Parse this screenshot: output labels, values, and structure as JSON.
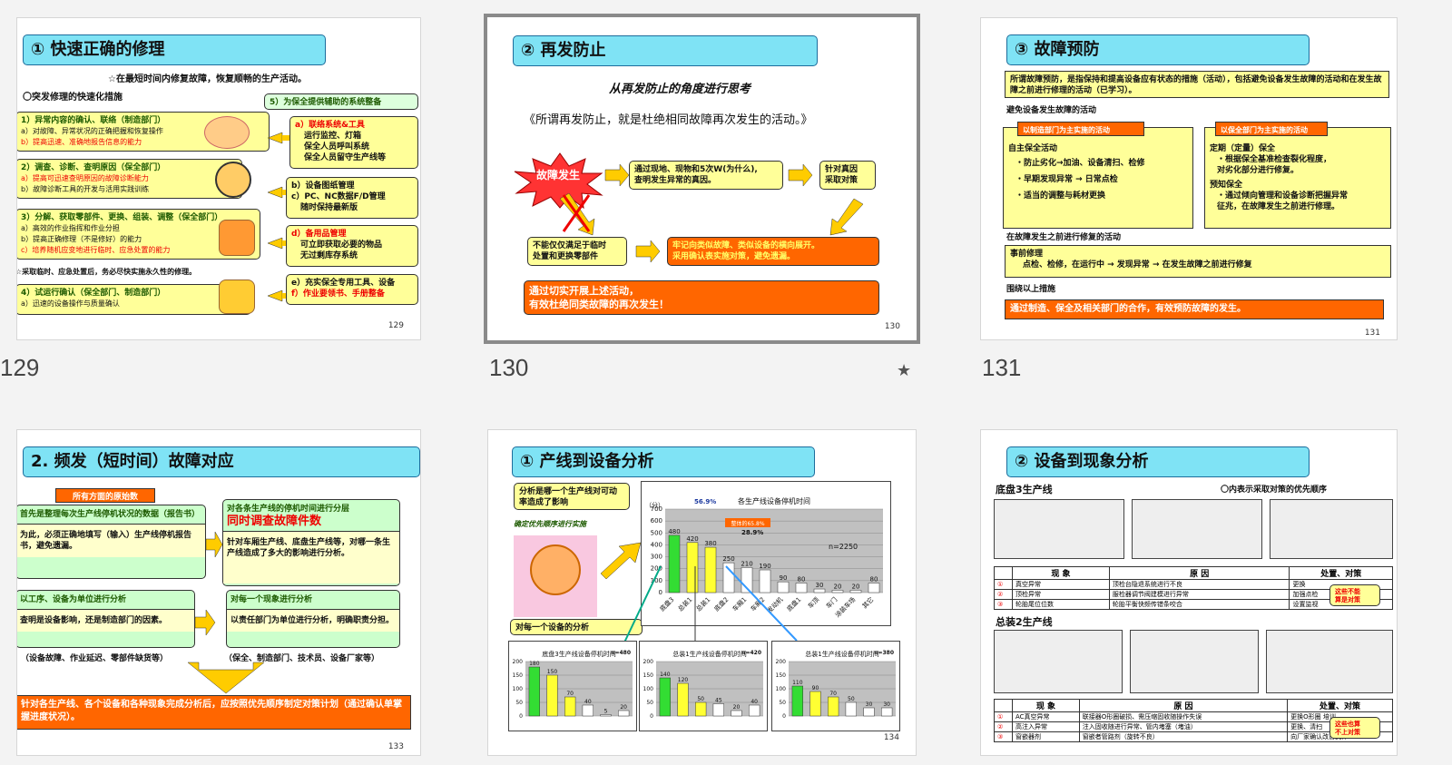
{
  "slides": [
    {
      "number": "129",
      "title": "① 快速正确的修理",
      "subtitle": "☆在最短时间内修复故障，恢复顺畅的生产活动。",
      "heading": "〇突发修理的快速化措施",
      "right_heading": "5）为保全提供辅助的系统整备",
      "left": [
        {
          "head": "1）异常内容的确认、联络（制造部门）",
          "l1": "a）对故障、异常状况的正确把握和恢复操作",
          "l2": "b）提高迅速、准确地报告信息的能力"
        },
        {
          "head": "2）调查、诊断、查明原因（保全部门）",
          "l1": "a）提高可迅速查明原因的故障诊断能力",
          "l2": "b）故障诊断工具的开发与活用实践训练"
        },
        {
          "head": "3）分解、获取零部件、更换、组装、调整（保全部门）",
          "l1": "a）高效的作业指挥和作业分担",
          "l2": "b）提高正确修理（不是修好）的能力",
          "l3": "c）培养随机应变地进行临时、应急处置的能力"
        },
        {
          "head": "4）试运行确认（保全部门、制造部门）",
          "l1": "a）迅速的设备操作与质量确认"
        }
      ],
      "note": "☆采取临时、应急处置后，务必尽快实施永久性的修理。",
      "right": [
        {
          "head": "a）联络系统&工具",
          "lines": [
            "运行监控、灯箱",
            "保全人员呼叫系统",
            "保全人员留守生产线等"
          ]
        },
        {
          "head": "b）设备图纸管理",
          "lines": [
            "c）PC、NC数据F/D管理",
            "随时保持最新版"
          ]
        },
        {
          "head": "d）备用品管理",
          "lines": [
            "可立即获取必要的物品",
            "无过剩库存系统"
          ]
        },
        {
          "head": "e）充实保全专用工具、设备",
          "lines": [
            "f）作业要领书、手册整备"
          ]
        }
      ]
    },
    {
      "number": "130",
      "title": "② 再发防止",
      "subtitle": "从再发防止的角度进行思考",
      "quote": "《所谓再发防止，就是杜绝相同故障再次发生的活动。》",
      "burst": "故障发生",
      "box1": "通过现地、现物和5次W(为什么),\n查明发生异常的真因。",
      "box2": "针对真因\n采取对策",
      "box3": "不能仅仅满足于临时\n处置和更换零部件",
      "box4": "牢记向类似故障、类似设备的横向展开。\n采用确认表实施对策，避免遗漏。",
      "bottom": "通过切实开展上述活动，\n有效杜绝同类故障的再次发生！"
    },
    {
      "number": "131",
      "title": "③ 故障预防",
      "intro": "所谓故障预防，是指保持和提高设备应有状态的措施（活动），包括避免设备发生故障的活动和在发生故障之前进行修理的活动（已学习）。",
      "sec1": "避免设备发生故障的活动",
      "tag_left": "以制造部门为主实施的活动",
      "tag_right": "以保全部门为主实施的活动",
      "left_lines": [
        "自主保全活动",
        "・防止劣化→加油、设备清扫、检修",
        "・早期发现异常  →  日常点检",
        "・适当的调整与耗材更换"
      ],
      "right_lines": [
        "定期（定量）保全",
        "・根据保全基准检查裂化程度，",
        "  对劣化部分进行修复。",
        "预知保全",
        "・通过倾向管理和设备诊断把握异常",
        "  征兆，在故障发生之前进行修理。"
      ],
      "sec2": "在故障发生之前进行修复的活动",
      "box2_head": "事前修理",
      "box2_line": "点检、检修，在运行中  →  发现异常  →  在发生故障之前进行修复",
      "sec3": "围绕以上措施",
      "bottom": "通过制造、保全及相关部门的合作，有效预防故障的发生。"
    },
    {
      "number": "133",
      "title": "2. 频发（短时间）故障对应",
      "tag": "所有方面的原始数",
      "b1h": "首先是整理每次生产线停机状况的数据（报告书）",
      "b1": "为此，必须正确地填写（输入）生产线停机报告书，避免遗漏。",
      "b2h": "对各条生产线的停机时间进行分层",
      "b2r": "同时调查故障件数",
      "b2": "针对车厢生产线、底盘生产线等，对哪一条生产线造成了多大的影响进行分析。",
      "b3h": "以工序、设备为单位进行分析",
      "b3": "查明是设备影响，还是制造部门的因素。",
      "b4h": "对每一个现象进行分析",
      "b4": "以责任部门为单位进行分析，明确职责分担。",
      "n1": "（设备故障、作业延迟、零部件缺货等）",
      "n2": "（保全、制造部门、技术员、设备厂家等）",
      "bottom": "针对各生产线、各个设备和各种现象完成分析后，应按照优先顺序制定对策计划（通过确认单掌握进度状况）。"
    },
    {
      "number": "134",
      "title": "① 产线到设备分析",
      "callout": "分析是哪一个生产线对可动率造成了影响",
      "italic": "确定优先顺序进行实施",
      "label2": "对每一个设备的分析"
    },
    {
      "number": "",
      "title": "② 设备到现象分析",
      "line1": "底盘3生产线",
      "legend": "〇内表示采取对策的优先顺序",
      "line2": "总装2生产线",
      "col1": "现 象",
      "col2": "原 因",
      "col3": "处置、对策",
      "t1": [
        [
          "真空异常",
          "顶检台隐退系统进行不良",
          "更换"
        ],
        [
          "顶检异常",
          "服检器调节阀建模进行异常",
          "加强点检"
        ],
        [
          "轮胎尾位位数",
          "轮胎平衡快频传错条咬合",
          "设置监视"
        ]
      ],
      "callout1": "这些不能\n算是对策",
      "t2": [
        [
          "AC真空异常",
          "联接器O形圈破损、需压缩固收随操作失误",
          "更换O形圈  培训"
        ],
        [
          "高注入异常",
          "注入固收随进行异常、管内堵塞（堵油）",
          "更换、清扫"
        ],
        [
          "窗嵌器剂",
          "窗嵌者管路剂（旋转不良）",
          "向厂家确认改善式样"
        ]
      ],
      "callout2": "这些也算\n不上对策"
    }
  ],
  "chart_data": [
    {
      "type": "bar",
      "title": "各生产线设备停机时间",
      "ylabel": "（分）",
      "categories": [
        "底盘3",
        "总装1",
        "总装1",
        "底盘2",
        "车厢1",
        "车厢2",
        "发动机",
        "底盘1",
        "车顶",
        "车门",
        "涂装车场",
        "其它"
      ],
      "values": [
        480,
        420,
        380,
        250,
        210,
        190,
        90,
        80,
        30,
        20,
        20,
        80
      ],
      "ylim": [
        0,
        700
      ],
      "annotations": [
        "56.9%",
        "28.9%",
        "整体的65.8%",
        "n=2250"
      ]
    },
    {
      "type": "bar",
      "title": "底盘3生产线设备停机时间",
      "values": [
        180,
        150,
        70,
        40,
        5,
        20
      ],
      "ylim": [
        0,
        200
      ],
      "annotations": [
        "n=480"
      ]
    },
    {
      "type": "bar",
      "title": "总装1生产线设备停机时间",
      "values": [
        140,
        120,
        50,
        45,
        20,
        40
      ],
      "ylim": [
        0,
        200
      ],
      "annotations": [
        "n=420"
      ]
    },
    {
      "type": "bar",
      "title": "总装1生产线设备停机时间",
      "values": [
        110,
        90,
        70,
        50,
        30,
        30
      ],
      "ylim": [
        0,
        200
      ],
      "annotations": [
        "n=380"
      ]
    }
  ],
  "page_numbers": [
    "129",
    "130",
    "131"
  ],
  "star_icon": "★"
}
